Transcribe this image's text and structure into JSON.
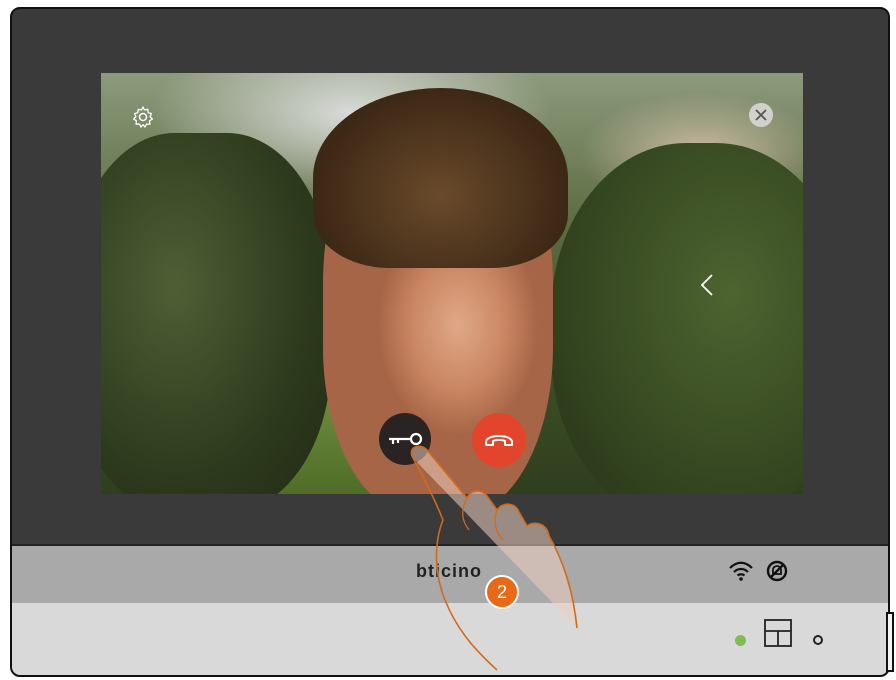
{
  "device": {
    "brand_text": "bticino"
  },
  "screen": {
    "buttons": {
      "settings_icon": "gear-icon",
      "close_icon": "close-icon",
      "back_icon": "chevron-left-icon",
      "unlock_icon": "key-icon",
      "hangup_icon": "phone-hangup-icon"
    }
  },
  "status_bar": {
    "wifi_icon": "wifi-icon",
    "dnd_icon": "bell-off-icon"
  },
  "base": {
    "led_color": "#7dbe52",
    "home_icon": "home-key-icon"
  },
  "instruction": {
    "step_number": "2"
  },
  "colors": {
    "hangup": "#e2452b",
    "unlock": "#2a2323",
    "badge": "#e86a16"
  }
}
